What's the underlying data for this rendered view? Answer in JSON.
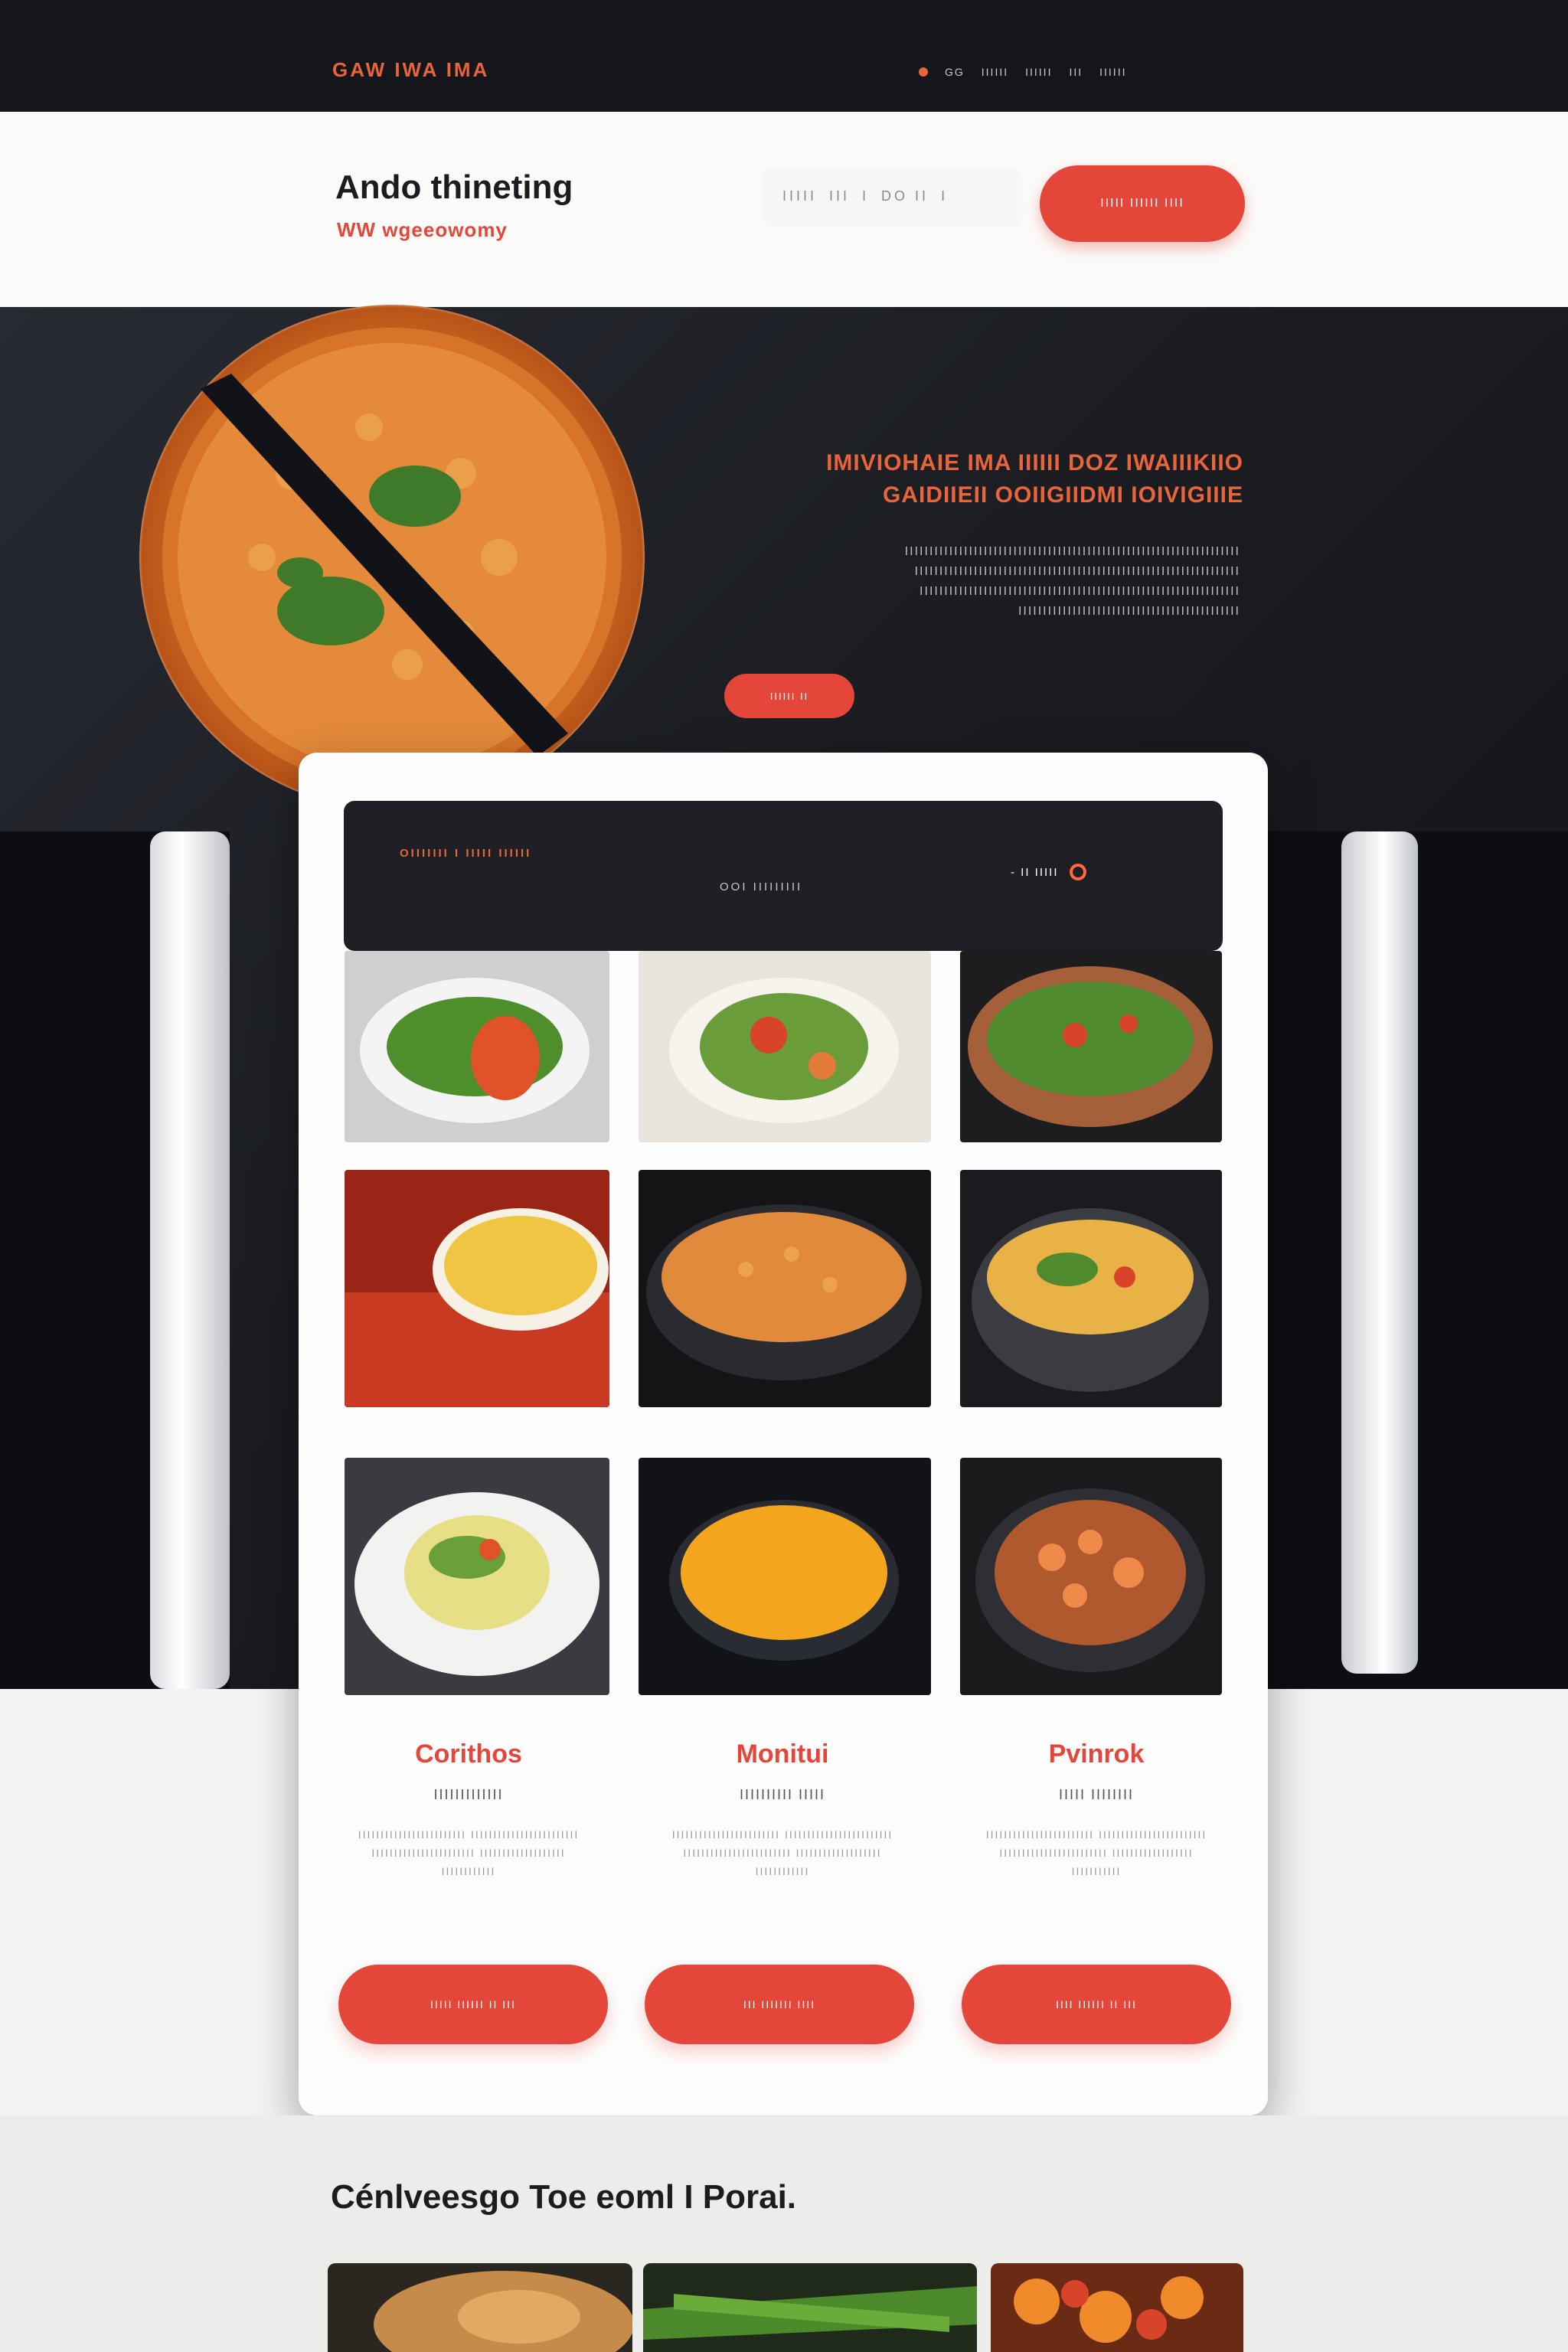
{
  "colors": {
    "accent": "#e4473a",
    "accent_text": "#e8643a",
    "dark": "#15161b"
  },
  "topbar": {
    "brand": "GAW IWA IMA",
    "nav": [
      "GG",
      "IIIIII",
      "IIIIII",
      "III",
      "IIIIII"
    ]
  },
  "header": {
    "title": "Ando thineting",
    "subtitle": "WW wgeeowomy",
    "search_placeholder": [
      "IIIII",
      "III",
      "I",
      "DO II",
      "I"
    ],
    "cta_label": "IIIII IIIIII IIII"
  },
  "hero": {
    "heading_line1": "IMIVIOHAIE IMA IIIIII DOZ IWAIIIKIIO",
    "heading_line2": "GAIDIIEII OOIIGIIDMI IOIVIGIIIE",
    "body": "IIIIIIIIIIIIIIIIIIIIIIIIIIIIIIIIIIIIIIIIIIIIIIIIIIIIIIIIIIIIIIIIIIII IIIIIIIIIIIIIIIIIIIIIIIIIIIIIIIIIIIIIIIIIIIIIIIIIIIIIIIIIIIIIIIIII IIIIIIIIIIIIIIIIIIIIIIIIIIIIIIIIIIIIIIIIIIIIIIIIIIIIIIIIIIIIIIIII IIIIIIIIIIIIIIIIIIIIIIIIIIIIIIIIIIIIIIIIIIIII",
    "button": "IIIIII II"
  },
  "card": {
    "top_left": "OIIIIIII I IIIII IIIIII",
    "top_mid": "OOI IIIIIIIII",
    "top_right": "-  II  IIIII",
    "ring_icon": "circle-icon"
  },
  "columns": [
    {
      "title": "Corithos",
      "sub": "IIIIIIIIIIIII",
      "body": "IIIIIIIIIIIIIIIIIIIIIIII IIIIIIIIIIIIIIIIIIIIIIII IIIIIIIIIIIIIIIIIIIIIII IIIIIIIIIIIIIIIIIII IIIIIIIIIIII",
      "button": "IIIII IIIIII II III"
    },
    {
      "title": "Monitui",
      "sub": "IIIIIIIIII IIIII",
      "body": "IIIIIIIIIIIIIIIIIIIIIIII IIIIIIIIIIIIIIIIIIIIIIII IIIIIIIIIIIIIIIIIIIIIIII IIIIIIIIIIIIIIIIIII IIIIIIIIIIII",
      "button": "III IIIIIII IIII"
    },
    {
      "title": "Pvinrok",
      "sub": "IIIII IIIIIIII",
      "body": "IIIIIIIIIIIIIIIIIIIIIIII IIIIIIIIIIIIIIIIIIIIIIII IIIIIIIIIIIIIIIIIIIIIIII IIIIIIIIIIIIIIIIII IIIIIIIIIII",
      "button": "IIII IIIIII II III"
    }
  ],
  "bottom": {
    "title": "Cénlveesgo Toe eoml I Porai."
  }
}
